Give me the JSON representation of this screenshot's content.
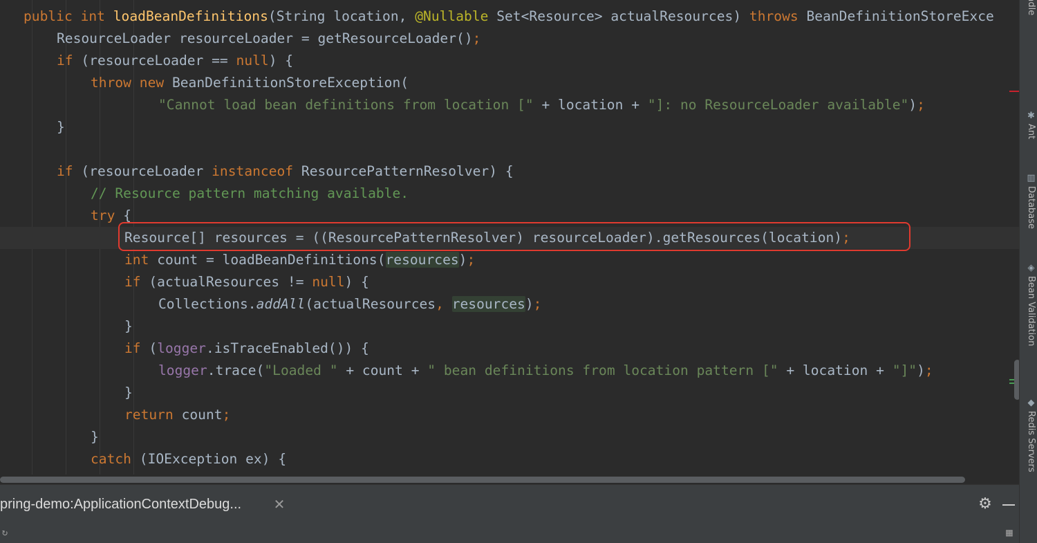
{
  "editor": {
    "lines": [
      {
        "current": false,
        "tokens": [
          {
            "t": "public int ",
            "c": "kw"
          },
          {
            "t": "loadBeanDefinitions",
            "c": "fn"
          },
          {
            "t": "(String location, "
          },
          {
            "t": "@Nullable ",
            "c": "ann"
          },
          {
            "t": "Set<Resource> actualResources) "
          },
          {
            "t": "throws ",
            "c": "kw"
          },
          {
            "t": "BeanDefinitionStoreExce"
          }
        ]
      },
      {
        "current": false,
        "tokens": [
          {
            "t": "ResourceLoader resourceLoader = getResourceLoader()"
          },
          {
            "t": ";",
            "c": "kw"
          }
        ]
      },
      {
        "current": false,
        "tokens": [
          {
            "t": "if ",
            "c": "kw"
          },
          {
            "t": "(resourceLoader == "
          },
          {
            "t": "null",
            "c": "kw"
          },
          {
            "t": ") {"
          }
        ]
      },
      {
        "current": false,
        "tokens": [
          {
            "t": "throw new ",
            "c": "kw"
          },
          {
            "t": "BeanDefinitionStoreException("
          }
        ]
      },
      {
        "current": false,
        "tokens": [
          {
            "t": "\"Cannot load bean definitions from location [\" ",
            "c": "str"
          },
          {
            "t": "+ location + "
          },
          {
            "t": "\"]: no ResourceLoader available\"",
            "c": "str"
          },
          {
            "t": ")"
          },
          {
            "t": ";",
            "c": "kw"
          }
        ]
      },
      {
        "current": false,
        "tokens": [
          {
            "t": "}"
          }
        ]
      },
      {
        "current": false,
        "tokens": []
      },
      {
        "current": false,
        "tokens": [
          {
            "t": "if ",
            "c": "kw"
          },
          {
            "t": "(resourceLoader "
          },
          {
            "t": "instanceof ",
            "c": "kw"
          },
          {
            "t": "ResourcePatternResolver) {"
          }
        ]
      },
      {
        "current": false,
        "tokens": [
          {
            "t": "// Resource pattern matching available.",
            "c": "cmt"
          }
        ]
      },
      {
        "current": false,
        "tokens": [
          {
            "t": "try ",
            "c": "kw"
          },
          {
            "t": "{"
          }
        ]
      },
      {
        "current": true,
        "tokens": [
          {
            "t": "Resource[] resources = ((ResourcePatternResolver) resourceLoader).getResources(location)"
          },
          {
            "t": ";",
            "c": "kw"
          }
        ]
      },
      {
        "current": false,
        "tokens": [
          {
            "t": "int ",
            "c": "kw"
          },
          {
            "t": "count = loadBeanDefinitions("
          },
          {
            "t": "resources",
            "c": "hl"
          },
          {
            "t": ")"
          },
          {
            "t": ";",
            "c": "kw"
          }
        ]
      },
      {
        "current": false,
        "tokens": [
          {
            "t": "if ",
            "c": "kw"
          },
          {
            "t": "(actualResources != "
          },
          {
            "t": "null",
            "c": "kw"
          },
          {
            "t": ") {"
          }
        ]
      },
      {
        "current": false,
        "tokens": [
          {
            "t": "Collections."
          },
          {
            "t": "addAll",
            "c": "ital"
          },
          {
            "t": "(actualResources"
          },
          {
            "t": ", ",
            "c": "kw"
          },
          {
            "t": "resources",
            "c": "hl"
          },
          {
            "t": ")"
          },
          {
            "t": ";",
            "c": "kw"
          }
        ]
      },
      {
        "current": false,
        "tokens": [
          {
            "t": "}"
          }
        ]
      },
      {
        "current": false,
        "tokens": [
          {
            "t": "if ",
            "c": "kw"
          },
          {
            "t": "("
          },
          {
            "t": "logger",
            "c": "fld"
          },
          {
            "t": ".isTraceEnabled()) {"
          }
        ]
      },
      {
        "current": false,
        "tokens": [
          {
            "t": "logger",
            "c": "fld"
          },
          {
            "t": ".trace("
          },
          {
            "t": "\"Loaded \" ",
            "c": "str"
          },
          {
            "t": "+ count + "
          },
          {
            "t": "\" bean definitions from location pattern [\" ",
            "c": "str"
          },
          {
            "t": "+ location + "
          },
          {
            "t": "\"]\"",
            "c": "str"
          },
          {
            "t": ")"
          },
          {
            "t": ";",
            "c": "kw"
          }
        ]
      },
      {
        "current": false,
        "tokens": [
          {
            "t": "}"
          }
        ]
      },
      {
        "current": false,
        "tokens": [
          {
            "t": "return ",
            "c": "kw"
          },
          {
            "t": "count"
          },
          {
            "t": ";",
            "c": "kw"
          }
        ]
      },
      {
        "current": false,
        "tokens": [
          {
            "t": "}"
          }
        ]
      },
      {
        "current": false,
        "tokens": [
          {
            "t": "catch ",
            "c": "kw"
          },
          {
            "t": "(IOException ex) {"
          }
        ]
      }
    ]
  },
  "right_panel": {
    "tabs": [
      {
        "label": "Gradle",
        "icon": "gradle-icon",
        "glyph": "▣"
      },
      {
        "label": "Ant",
        "icon": "ant-icon",
        "glyph": "✱"
      },
      {
        "label": "Database",
        "icon": "database-icon",
        "glyph": "▥"
      },
      {
        "label": "Bean Validation",
        "icon": "bean-validation-icon",
        "glyph": "◈"
      },
      {
        "label": "Redis Servers",
        "icon": "redis-icon",
        "glyph": "◆"
      }
    ]
  },
  "run_bar": {
    "tab_label": "pring-demo:ApplicationContextDebug..."
  },
  "colors": {
    "keyword": "#cc7832",
    "method": "#ffc66d",
    "string": "#6a8759",
    "comment": "#629755",
    "annotation": "#bbb529",
    "field": "#9876aa",
    "highlight_box": "#e03a2f"
  }
}
